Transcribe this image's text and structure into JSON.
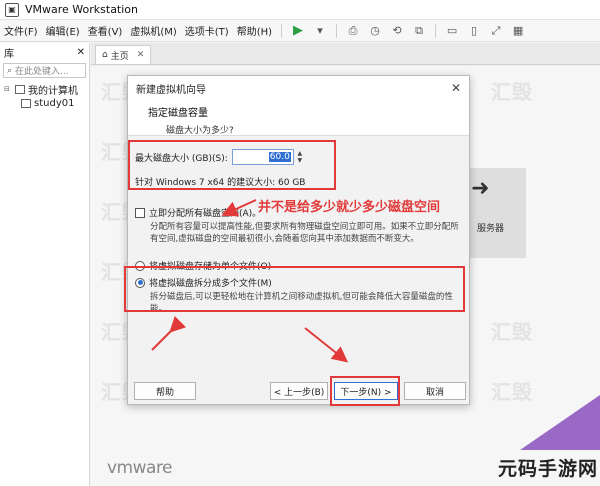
{
  "window": {
    "title": "VMware Workstation"
  },
  "menu": [
    "文件(F)",
    "编辑(E)",
    "查看(V)",
    "虚拟机(M)",
    "选项卡(T)",
    "帮助(H)"
  ],
  "toolbar_icons": [
    "play-icon",
    "dropdown-icon",
    "screenshot-icon",
    "snapshot-icon",
    "snapshot-manager-icon",
    "console-icon",
    "fullscreen-icon",
    "unity-icon",
    "stretch-icon"
  ],
  "library": {
    "title": "库",
    "search_placeholder": "在此处键入...",
    "root": "我的计算机",
    "vm": "study01"
  },
  "tab": {
    "label": "主页"
  },
  "home": {
    "remote_label": "服务器",
    "watermark": "汇毁",
    "brand": "vmware"
  },
  "dialog": {
    "title": "新建虚拟机向导",
    "heading": "指定磁盘容量",
    "subheading": "磁盘大小为多少?",
    "size_label": "最大磁盘大小 (GB)(S):",
    "size_value": "60.0",
    "recommend": "针对 Windows 7 x64 的建议大小: 60 GB",
    "allocate_label": "立即分配所有磁盘空间(A)。",
    "allocate_desc": "分配所有容量可以提高性能,但要求所有物理磁盘空间立即可用。如果不立即分配所有空间,虚拟磁盘的空间最初很小,会随着您向其中添加数据而不断变大。",
    "single_label": "将虚拟磁盘存储为单个文件(O)",
    "split_label": "将虚拟磁盘拆分成多个文件(M)",
    "split_desc": "拆分磁盘后,可以更轻松地在计算机之间移动虚拟机,但可能会降低大容量磁盘的性能。",
    "buttons": {
      "help": "帮助",
      "back": "< 上一步(B)",
      "next": "下一步(N) >",
      "cancel": "取消"
    }
  },
  "annotation": {
    "text": "并不是给多少就少多少磁盘空间",
    "color": "#e23a3a"
  },
  "site_watermark": "元码手游网",
  "colors": {
    "accent": "#2f6fd1",
    "annotation": "#e23a3a",
    "corner": "#7a3ab4"
  }
}
